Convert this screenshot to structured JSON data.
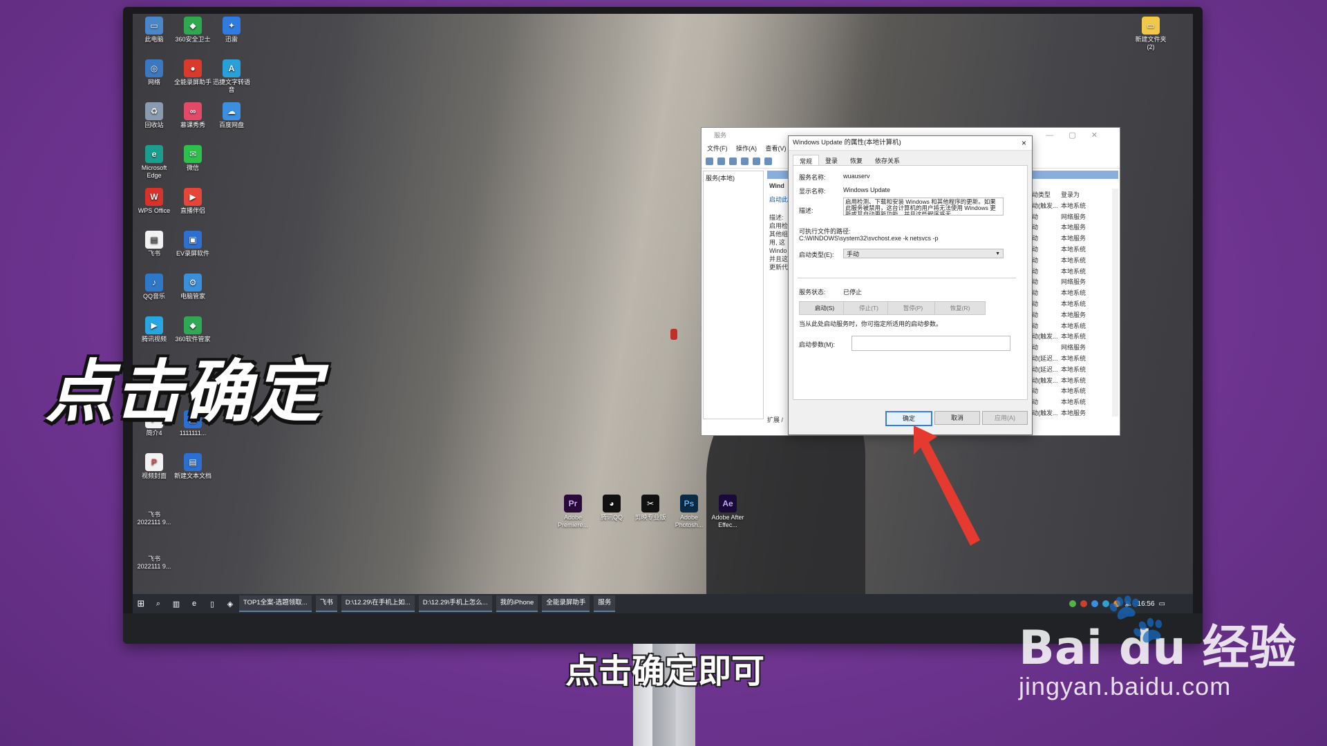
{
  "desktop_icons": [
    {
      "label": "此电脑"
    },
    {
      "label": "360安全卫士"
    },
    {
      "label": "迅雷"
    },
    {
      "label": "网络"
    },
    {
      "label": "全能录屏助手"
    },
    {
      "label": "迅捷文字转语音"
    },
    {
      "label": "回收站"
    },
    {
      "label": "慕课秀秀"
    },
    {
      "label": "百度网盘"
    },
    {
      "label": "Microsoft Edge"
    },
    {
      "label": "微信"
    },
    {
      "label": "WPS Office"
    },
    {
      "label": "直播伴侣"
    },
    {
      "label": "飞书"
    },
    {
      "label": "EV录屏软件"
    },
    {
      "label": "QQ音乐"
    },
    {
      "label": "电脑管家"
    },
    {
      "label": "腾讯视频"
    },
    {
      "label": "360软件管家"
    },
    {
      "label": "简介4"
    },
    {
      "label": "1111111..."
    },
    {
      "label": "视频封面"
    },
    {
      "label": "新建文本文档"
    },
    {
      "label": "飞书 2022111 9..."
    },
    {
      "label": "飞书 2022111 9..."
    },
    {
      "label": "新建文件夹 (2)"
    },
    {
      "label": "Adobe Premiere..."
    },
    {
      "label": "腾讯QQ"
    },
    {
      "label": "剪映专业版"
    },
    {
      "label": "Adobe Photosh..."
    },
    {
      "label": "Adobe After Effec..."
    }
  ],
  "captions": {
    "big": "点击确定",
    "subtitle": "点击确定即可"
  },
  "watermark": {
    "logo": "Bai du 经验",
    "url": "jingyan.baidu.com"
  },
  "services_window": {
    "title": "服务",
    "menu": [
      "文件(F)",
      "操作(A)",
      "查看(V)"
    ],
    "tree_item": "服务(本地)",
    "left_pane": [
      "Wind",
      "启动此",
      "描述:",
      "启用检",
      "其他组",
      "用, 这",
      "Windo",
      "并且这",
      "更新代"
    ],
    "bottom_tab": "扩展 /",
    "rows": [
      [
        "动类型",
        "登录为"
      ],
      [
        "动(触发...",
        "本地系统"
      ],
      [
        "动",
        "网络服务"
      ],
      [
        "动",
        "本地服务"
      ],
      [
        "动",
        "本地服务"
      ],
      [
        "动",
        "本地系统"
      ],
      [
        "动",
        "本地系统"
      ],
      [
        "动",
        "本地系统"
      ],
      [
        "动",
        "网络服务"
      ],
      [
        "动",
        "本地系统"
      ],
      [
        "动",
        "本地系统"
      ],
      [
        "动",
        "本地服务"
      ],
      [
        "动",
        "本地系统"
      ],
      [
        "动(触发...",
        "本地系统"
      ],
      [
        "动",
        "网络服务"
      ],
      [
        "动(延迟...",
        "本地系统"
      ],
      [
        "动(延迟...",
        "本地系统"
      ],
      [
        "动(触发...",
        "本地系统"
      ],
      [
        "动",
        "本地系统"
      ],
      [
        "动",
        "本地系统"
      ],
      [
        "动(触发...",
        "本地服务"
      ]
    ]
  },
  "dialog": {
    "title": "Windows Update 的属性(本地计算机)",
    "close": "×",
    "tabs": [
      "常规",
      "登录",
      "恢复",
      "依存关系"
    ],
    "service_name_label": "服务名称:",
    "service_name": "wuauserv",
    "display_name_label": "显示名称:",
    "display_name": "Windows Update",
    "desc_label": "描述:",
    "desc": "启用检测、下载和安装 Windows 和其他程序的更新。如果此服务被禁用，这台计算机的用户将无法使用 Windows 更新或其自动更新功能，并且这些程序将无",
    "path_label": "可执行文件的路径:",
    "path": "C:\\WINDOWS\\system32\\svchost.exe -k netsvcs -p",
    "startup_label": "启动类型(E):",
    "startup_value": "手动",
    "status_label": "服务状态:",
    "status_value": "已停止",
    "buttons": {
      "start": "启动(S)",
      "stop": "停止(T)",
      "pause": "暂停(P)",
      "resume": "恢复(R)"
    },
    "hint": "当从此处启动服务时，你可指定所适用的启动参数。",
    "param_label": "启动参数(M):",
    "ok": "确定",
    "cancel": "取消",
    "apply": "应用(A)"
  },
  "taskbar": {
    "tasks": [
      "TOP1全案-选题领取...",
      "飞书",
      "D:\\12.29\\在手机上如...",
      "D:\\12.29\\手机上怎么...",
      "我的iPhone",
      "全能录屏助手",
      "服务"
    ],
    "clock": "16:56"
  }
}
